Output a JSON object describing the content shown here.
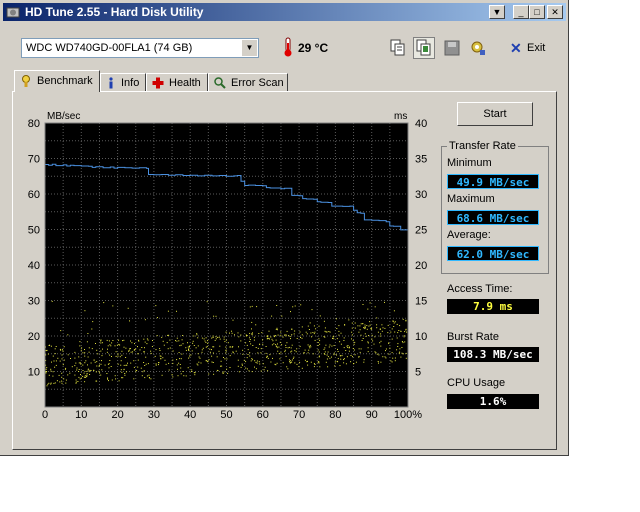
{
  "window": {
    "title": "HD Tune 2.55 - Hard Disk Utility"
  },
  "caption_buttons": {
    "dropdown": "▼",
    "minimize": "_",
    "maximize": "□",
    "close": "✕"
  },
  "toolbar": {
    "drive": "WDC WD740GD-00FLA1 (74 GB)",
    "temperature": "29 °C",
    "icons": [
      "copy-icon",
      "copy-text-icon",
      "save-icon",
      "options-icon"
    ],
    "exit_label": "Exit"
  },
  "tabs": [
    {
      "label": "Benchmark",
      "icon": "benchmark-icon",
      "active": true
    },
    {
      "label": "Info",
      "icon": "info-icon",
      "active": false
    },
    {
      "label": "Health",
      "icon": "health-icon",
      "active": false
    },
    {
      "label": "Error Scan",
      "icon": "error-scan-icon",
      "active": false
    }
  ],
  "benchmark": {
    "start_label": "Start",
    "transfer_rate_title": "Transfer Rate",
    "minimum_label": "Minimum",
    "minimum_value": "49.9 MB/sec",
    "maximum_label": "Maximum",
    "maximum_value": "68.6 MB/sec",
    "average_label": "Average:",
    "average_value": "62.0 MB/sec",
    "access_time_label": "Access Time:",
    "access_time_value": "7.9 ms",
    "burst_rate_label": "Burst Rate",
    "burst_rate_value": "108.3 MB/sec",
    "cpu_usage_label": "CPU Usage",
    "cpu_usage_value": "1.6%"
  },
  "chart_data": {
    "type": "line",
    "ylabel": "MB/sec",
    "y2label": "ms",
    "ylim": [
      0,
      80
    ],
    "y2lim": [
      0,
      40
    ],
    "yticks": [
      "80",
      "70",
      "60",
      "50",
      "40",
      "30",
      "20",
      "10"
    ],
    "y2ticks": [
      "40",
      "35",
      "30",
      "25",
      "20",
      "15",
      "10",
      "5"
    ],
    "xticks": [
      "0",
      "10",
      "20",
      "30",
      "40",
      "50",
      "60",
      "70",
      "80",
      "90",
      "100%"
    ],
    "grid": true,
    "series": [
      {
        "kind": "transfer_rate",
        "color": "#4a90e0",
        "x": [
          0,
          1,
          2,
          3,
          5,
          6,
          7,
          8,
          10,
          12,
          13,
          14,
          16,
          18,
          19,
          20,
          22,
          24,
          26,
          28,
          28.5,
          30,
          32,
          34,
          36,
          38,
          40,
          42,
          44,
          46,
          48,
          50,
          52,
          53,
          54,
          55,
          56,
          58,
          60,
          61,
          62,
          64,
          65,
          66,
          68,
          70,
          71,
          72,
          74,
          75,
          76,
          78,
          79,
          80,
          82,
          84,
          85,
          86,
          87,
          88,
          90,
          92,
          94,
          95,
          96,
          98,
          100
        ],
        "y": [
          68.3,
          68.1,
          68.4,
          68.0,
          68.2,
          67.9,
          68.1,
          68.0,
          67.9,
          67.8,
          67.5,
          67.7,
          67.4,
          67.6,
          67.3,
          67.5,
          67.4,
          67.3,
          67.4,
          67.2,
          65.5,
          65.4,
          65.5,
          65.3,
          65.4,
          65.2,
          65.3,
          65.1,
          65.3,
          65.1,
          65.2,
          65.0,
          65.1,
          65.2,
          63.6,
          62.4,
          62.5,
          62.4,
          62.3,
          61.8,
          61.7,
          61.7,
          61.5,
          61.6,
          59.6,
          59.5,
          58.7,
          58.6,
          58.5,
          57.8,
          57.7,
          57.6,
          56.6,
          56.6,
          56.5,
          56.6,
          55.4,
          54.7,
          54.6,
          52.7,
          52.6,
          52.5,
          52.2,
          51.0,
          50.9,
          49.9,
          50.0
        ]
      },
      {
        "kind": "access_time",
        "color": "#e6e640",
        "style": "scatter",
        "note_points": "random samples concentrated between 3 and 13 ms"
      }
    ]
  }
}
